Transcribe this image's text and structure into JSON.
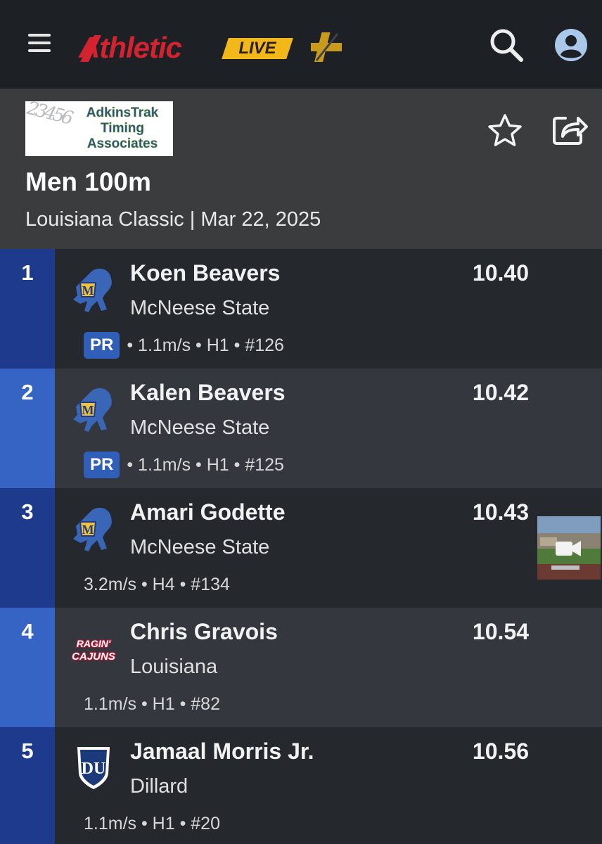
{
  "header": {
    "logo_word": "Athletic",
    "logo_live": "LIVE",
    "icons": [
      "menu-icon",
      "plus-icon",
      "search-icon",
      "account-icon"
    ]
  },
  "event": {
    "sponsor": {
      "numbers": "23456",
      "line1": "AdkinsTrak",
      "line2": "Timing",
      "line3": "Associates"
    },
    "title": "Men 100m",
    "subtitle": "Louisiana Classic | Mar 22, 2025",
    "icons": [
      "star-icon",
      "share-icon"
    ]
  },
  "colors": {
    "brand_red": "#d4232e",
    "brand_gold": "#f2b81a",
    "place_dark": "#1d3a8c",
    "place_light": "#3564c4",
    "pr_badge": "#2f5fb8"
  },
  "results": [
    {
      "place": "1",
      "athlete": "Koen Beavers",
      "team": "McNeese State",
      "mark": "10.40",
      "pr": "PR",
      "details": "• 1.1m/s • H1 • #126"
    },
    {
      "place": "2",
      "athlete": "Kalen Beavers",
      "team": "McNeese State",
      "mark": "10.42",
      "pr": "PR",
      "details": "• 1.1m/s • H1 • #125"
    },
    {
      "place": "3",
      "athlete": "Amari Godette",
      "team": "McNeese State",
      "mark": "10.43",
      "pr": "",
      "details": "3.2m/s • H4 • #134"
    },
    {
      "place": "4",
      "athlete": "Chris Gravois",
      "team": "Louisiana",
      "mark": "10.54",
      "pr": "",
      "details": "1.1m/s • H1 • #82",
      "logo_line1": "RAGIN'",
      "logo_line2": "CAJUNS"
    },
    {
      "place": "5",
      "athlete": "Jamaal Morris Jr.",
      "team": "Dillard",
      "mark": "10.56",
      "pr": "",
      "details": "1.1m/s • H1 • #20",
      "logo_text": "DU"
    }
  ]
}
